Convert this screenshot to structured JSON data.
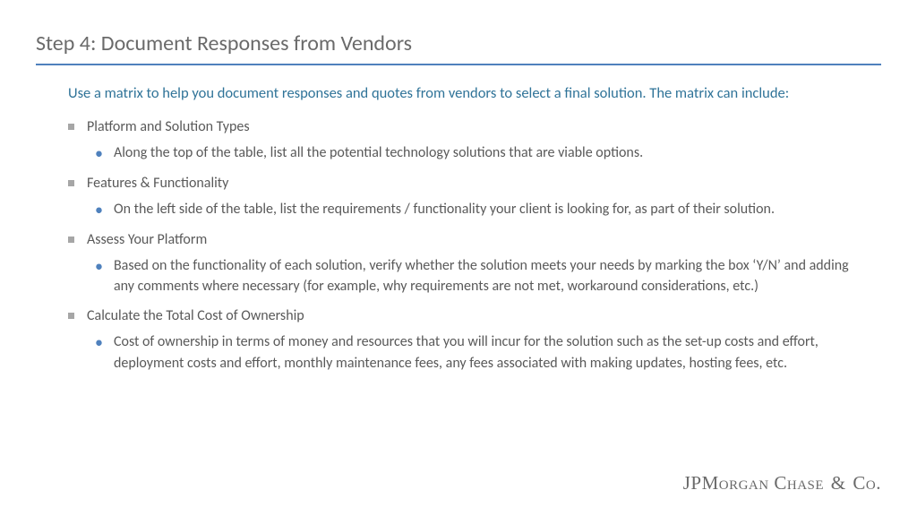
{
  "title": "Step 4: Document Responses from Vendors",
  "intro": "Use a matrix to help you document responses and quotes from vendors to select a final solution. The matrix can include:",
  "items": [
    {
      "label": "Platform and Solution Types",
      "sub": "Along the top of the table, list all the potential technology solutions that are viable options."
    },
    {
      "label": "Features & Functionality",
      "sub": "On the left side of the table, list the requirements / functionality your client is looking for, as part of their solution."
    },
    {
      "label": "Assess Your Platform",
      "sub": "Based on the functionality of each solution, verify whether the solution meets your needs by marking the box ‘Y/N’ and adding any comments where necessary (for example, why requirements are not met, workaround considerations, etc.)"
    },
    {
      "label": "Calculate the Total Cost of Ownership",
      "sub": "Cost of ownership in terms of money and resources that you will incur for the solution such as the set-up costs and effort, deployment costs and effort, monthly maintenance fees,  any fees associated with making updates, hosting fees, etc."
    }
  ],
  "logo": {
    "a": "JPM",
    "b": "organ",
    "c": " C",
    "d": "hase",
    "e": " & ",
    "f": "C",
    "g": "o."
  }
}
